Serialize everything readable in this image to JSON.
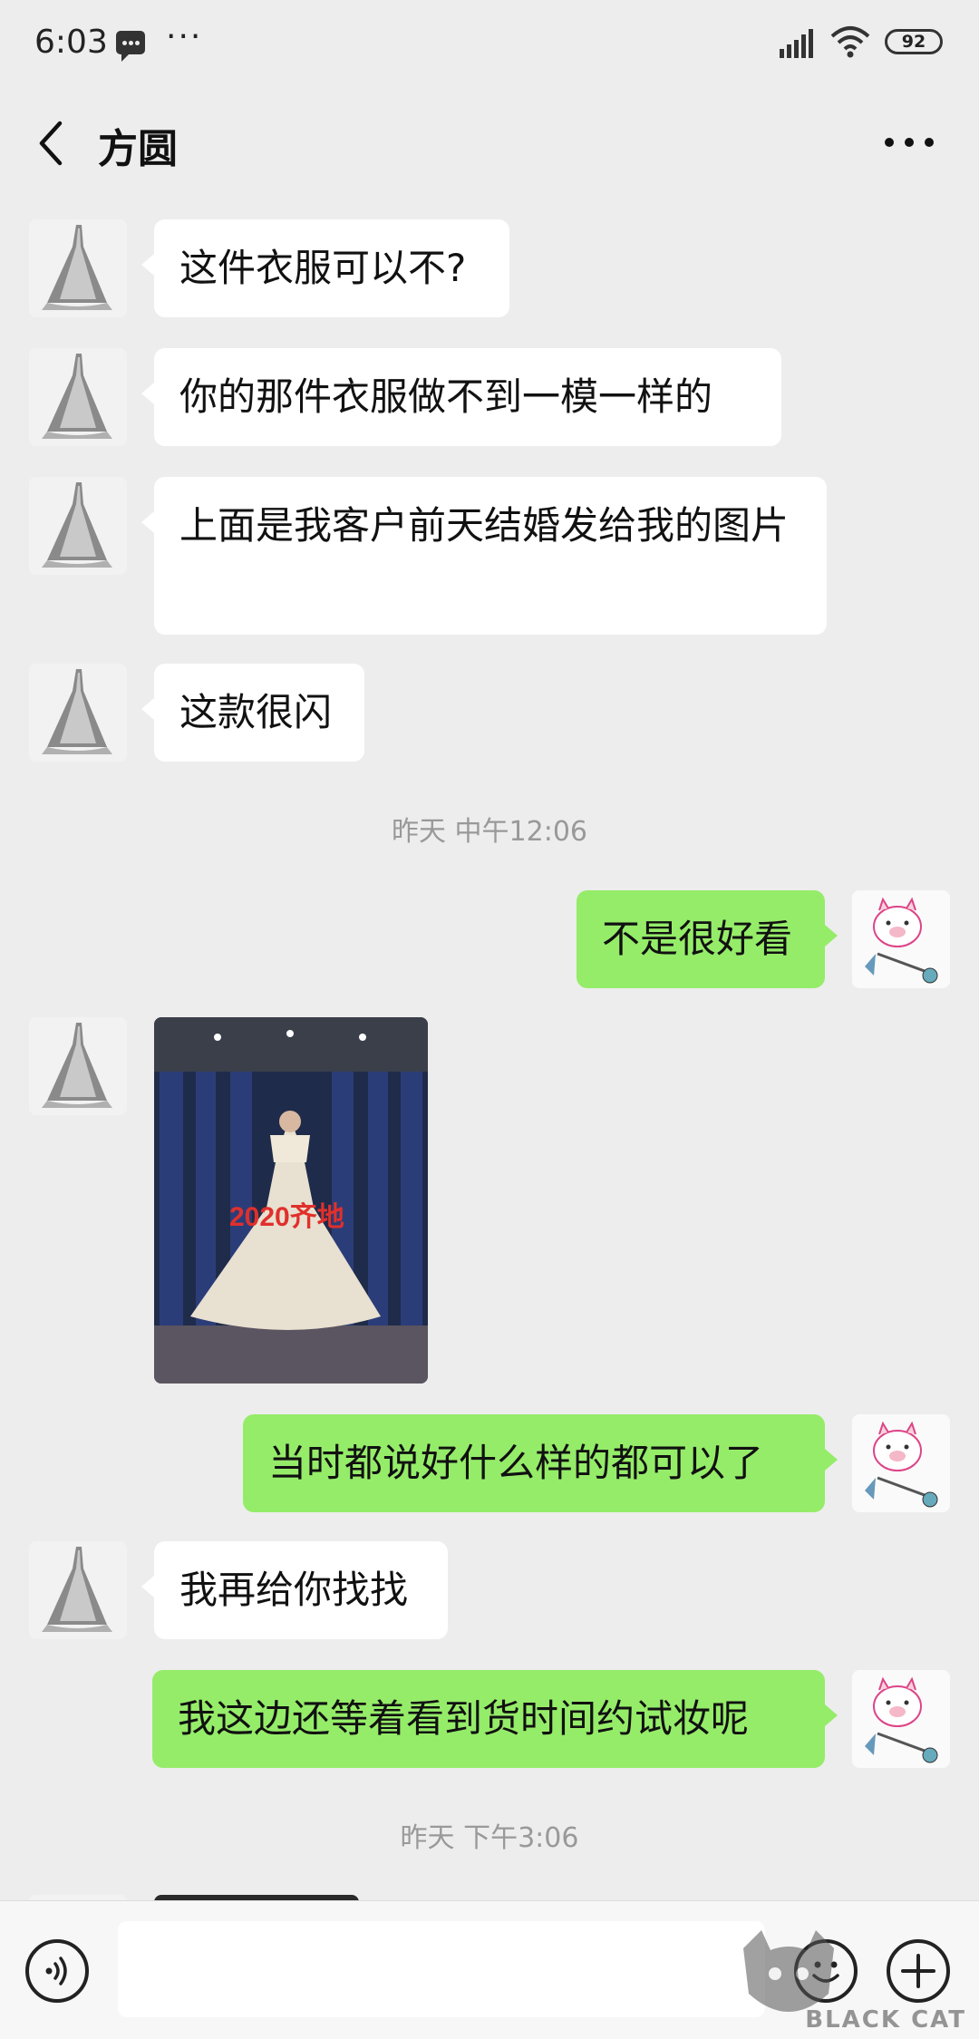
{
  "status_bar": {
    "time": "6:03",
    "battery": "92",
    "overflow": "···"
  },
  "header": {
    "title": "方圆"
  },
  "messages": [
    {
      "text": "这件衣服可以不?"
    },
    {
      "text": "你的那件衣服做不到一模一样的"
    },
    {
      "text": "上面是我客户前天结婚发给我的图片"
    },
    {
      "text": "这款很闪"
    },
    {
      "text": "不是很好看"
    },
    {
      "text": "当时都说好什么样的都可以了"
    },
    {
      "text": "我再给你找找"
    },
    {
      "text": "我这边还等着看到货时间约试妆呢"
    }
  ],
  "timestamps": [
    "昨天 中午12:06",
    "昨天 下午3:06"
  ],
  "photo": {
    "caption": "2020齐地"
  },
  "input": {
    "placeholder": ""
  },
  "watermark": {
    "text": "BLACK CAT"
  },
  "colors": {
    "background": "#ededed",
    "outgoing_bubble": "#95ec69",
    "incoming_bubble": "#ffffff"
  }
}
